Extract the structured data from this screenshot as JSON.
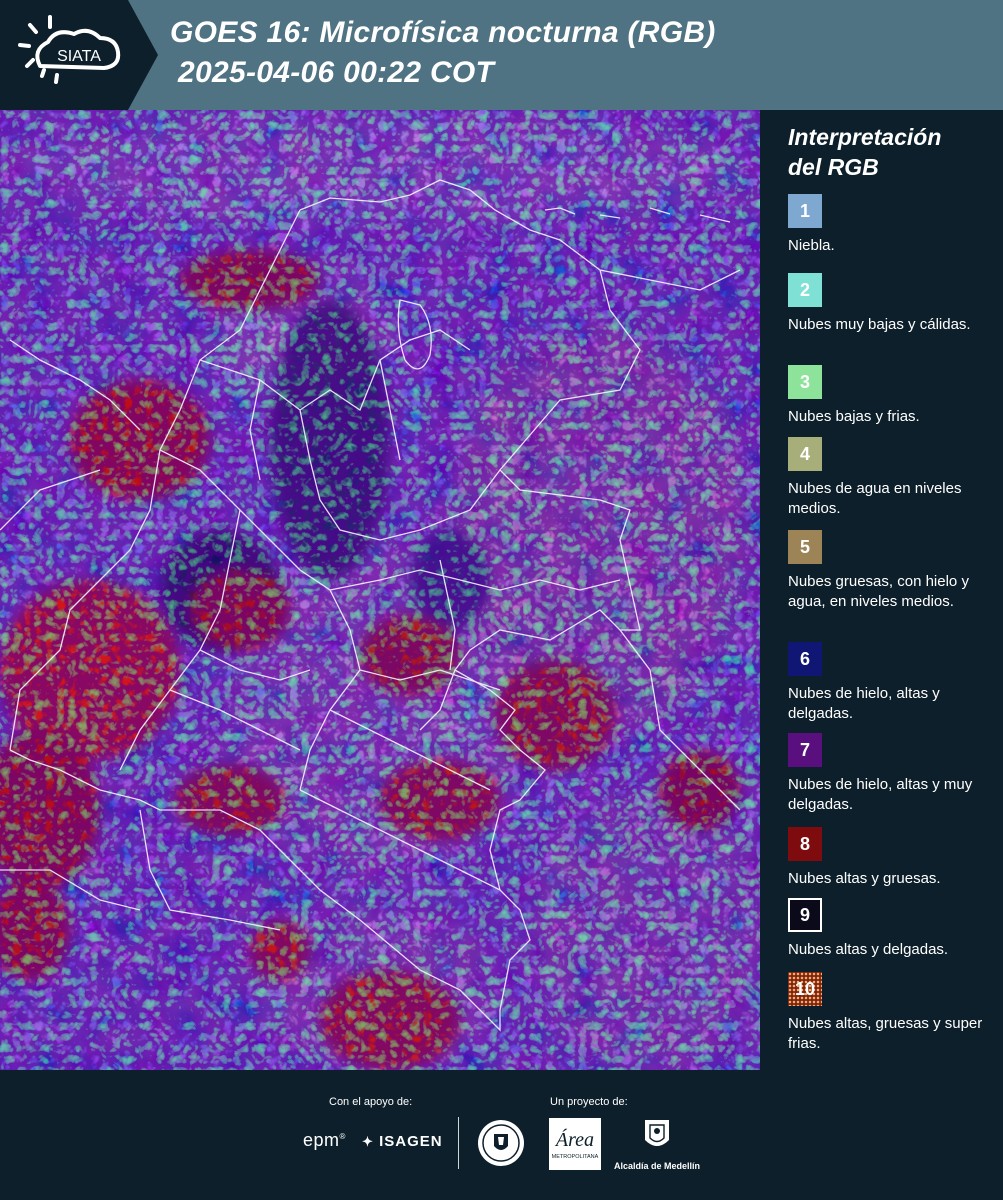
{
  "header": {
    "logo_text": "SIATA",
    "title_line1": "GOES 16: Microfísica nocturna (RGB)",
    "title_line2": "2025-04-06 00:22 COT"
  },
  "legend": {
    "title_line1": "Interpretación",
    "title_line2": "del RGB",
    "items": [
      {
        "number": "1",
        "label": "Niebla.",
        "color": "#7ea8cf"
      },
      {
        "number": "2",
        "label": "Nubes muy bajas y cálidas.",
        "color": "#7fe1d6"
      },
      {
        "number": "3",
        "label": "Nubes bajas y frias.",
        "color": "#8ee39a"
      },
      {
        "number": "4",
        "label": "Nubes de agua en niveles medios.",
        "color": "#a7ae7a"
      },
      {
        "number": "5",
        "label": "Nubes gruesas, con hielo y agua, en niveles medios.",
        "color": "#9d8457"
      },
      {
        "number": "6",
        "label": "Nubes de hielo, altas y delgadas.",
        "color": "#0f1674"
      },
      {
        "number": "7",
        "label": "Nubes de hielo, altas y muy delgadas.",
        "color": "#5a0f7e"
      },
      {
        "number": "8",
        "label": "Nubes altas y gruesas.",
        "color": "#7e0c0e"
      },
      {
        "number": "9",
        "label": "Nubes altas y delgadas.",
        "color": "#0a0a1a"
      },
      {
        "number": "10",
        "label": "Nubes altas, gruesas y super frias.",
        "color": "#8a1d12"
      }
    ]
  },
  "footer": {
    "support_label": "Con el apoyo de:",
    "project_label": "Un proyecto de:",
    "epm_logo": "epm",
    "isagen_logo": "ISAGEN",
    "area_logo_text": "Área",
    "area_logo_sub": "METROPOLITANA",
    "alcaldia_label": "Alcaldía de Medellín"
  }
}
